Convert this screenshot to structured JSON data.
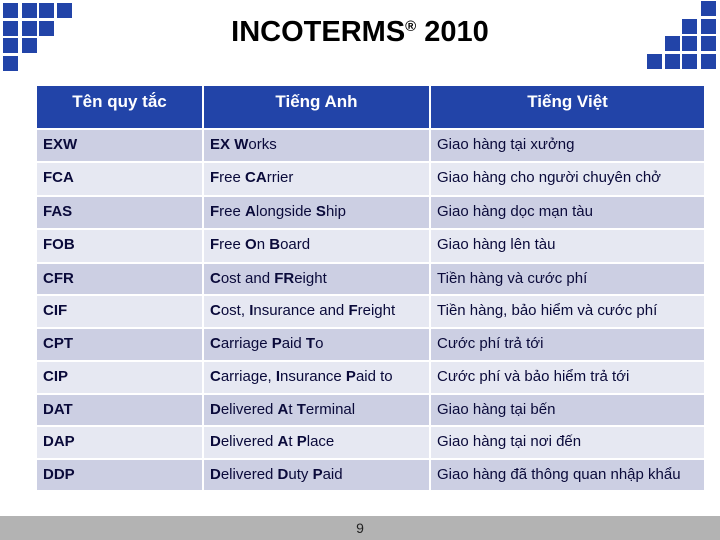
{
  "title": {
    "text": "INCOTERMS",
    "registered_mark": "®",
    "year": "2010"
  },
  "colors": {
    "accent": "#2244a8",
    "row_dark": "#cccfe3",
    "row_light": "#e6e8f2",
    "footer": "#b3b3b3"
  },
  "table": {
    "headers": [
      "Tên quy tắc",
      "Tiếng Anh",
      "Tiếng Việt"
    ],
    "rows": [
      {
        "code": "EXW",
        "english": [
          [
            "EX ",
            true
          ],
          [
            "W",
            true
          ],
          [
            "orks",
            false
          ]
        ],
        "english_text": "EX Works",
        "vietnamese": "Giao hàng tại xưởng"
      },
      {
        "code": "FCA",
        "english": [
          [
            "F",
            true
          ],
          [
            "ree ",
            false
          ],
          [
            "CA",
            true
          ],
          [
            "rrier",
            false
          ]
        ],
        "english_text": "Free CArrier",
        "vietnamese": "Giao hàng cho người chuyên chở"
      },
      {
        "code": "FAS",
        "english": [
          [
            "F",
            true
          ],
          [
            "ree ",
            false
          ],
          [
            "A",
            true
          ],
          [
            "longside ",
            false
          ],
          [
            "S",
            true
          ],
          [
            "hip",
            false
          ]
        ],
        "english_text": "Free Alongside Ship",
        "vietnamese": "Giao hàng dọc mạn tàu"
      },
      {
        "code": "FOB",
        "english": [
          [
            "F",
            true
          ],
          [
            "ree ",
            false
          ],
          [
            "O",
            true
          ],
          [
            "n ",
            false
          ],
          [
            "B",
            true
          ],
          [
            "oard",
            false
          ]
        ],
        "english_text": "Free On Board",
        "vietnamese": "Giao hàng lên tàu"
      },
      {
        "code": "CFR",
        "english": [
          [
            "C",
            true
          ],
          [
            "ost and ",
            false
          ],
          [
            "FR",
            true
          ],
          [
            "eight",
            false
          ]
        ],
        "english_text": "Cost and FReight",
        "vietnamese": "Tiền hàng và cước phí"
      },
      {
        "code": "CIF",
        "english": [
          [
            "C",
            true
          ],
          [
            "ost, ",
            false
          ],
          [
            "I",
            true
          ],
          [
            "nsurance and ",
            false
          ],
          [
            "F",
            true
          ],
          [
            "reight",
            false
          ]
        ],
        "english_text": "Cost, Insurance and Freight",
        "vietnamese": "Tiền hàng, bảo hiểm và cước phí"
      },
      {
        "code": "CPT",
        "english": [
          [
            "C",
            true
          ],
          [
            "arriage ",
            false
          ],
          [
            "P",
            true
          ],
          [
            "aid ",
            false
          ],
          [
            "T",
            true
          ],
          [
            "o",
            false
          ]
        ],
        "english_text": "Carriage Paid To",
        "vietnamese": "Cước phí trả tới"
      },
      {
        "code": "CIP",
        "english": [
          [
            "C",
            true
          ],
          [
            "arriage, ",
            false
          ],
          [
            "I",
            true
          ],
          [
            "nsurance ",
            false
          ],
          [
            "P",
            true
          ],
          [
            "aid to",
            false
          ]
        ],
        "english_text": "Carriage, Insurance Paid to",
        "vietnamese": "Cước phí và bảo hiểm trả tới"
      },
      {
        "code": "DAT",
        "english": [
          [
            "D",
            true
          ],
          [
            "elivered ",
            false
          ],
          [
            "A",
            true
          ],
          [
            "t ",
            false
          ],
          [
            "T",
            true
          ],
          [
            "erminal",
            false
          ]
        ],
        "english_text": "Delivered At Terminal",
        "vietnamese": "Giao hàng tại bến"
      },
      {
        "code": "DAP",
        "english": [
          [
            "D",
            true
          ],
          [
            "elivered ",
            false
          ],
          [
            "A",
            true
          ],
          [
            "t ",
            false
          ],
          [
            "P",
            true
          ],
          [
            "lace",
            false
          ]
        ],
        "english_text": "Delivered At Place",
        "vietnamese": "Giao hàng tại nơi đến"
      },
      {
        "code": "DDP",
        "english": [
          [
            "D",
            true
          ],
          [
            "elivered ",
            false
          ],
          [
            "D",
            true
          ],
          [
            "uty ",
            false
          ],
          [
            "P",
            true
          ],
          [
            "aid",
            false
          ]
        ],
        "english_text": "Delivered Duty Paid",
        "vietnamese": "Giao hàng đã thông quan nhập khẩu"
      }
    ]
  },
  "footer": {
    "page_number": "9"
  },
  "decorations": {
    "top_left_icon": "blue-squares-staircase",
    "top_right_icon": "blue-squares-staircase"
  }
}
